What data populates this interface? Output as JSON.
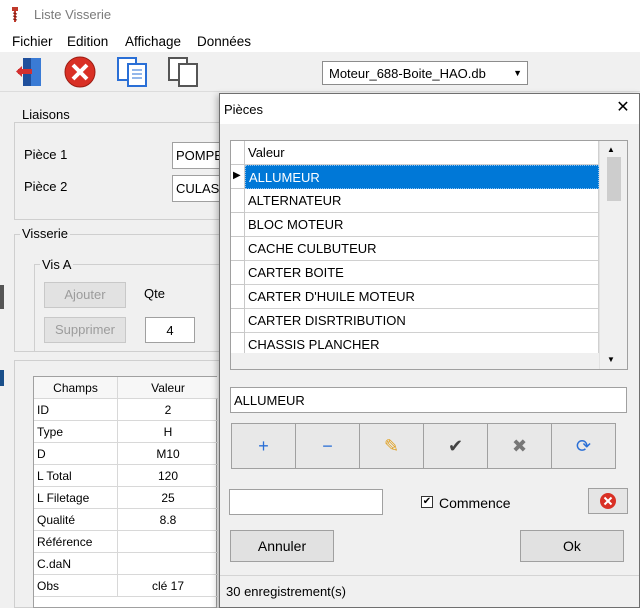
{
  "window": {
    "title": "Liste Visserie"
  },
  "menu": [
    "Fichier",
    "Edition",
    "Affichage",
    "Données"
  ],
  "toolbar": {
    "buttons": [
      {
        "icon": "exit-door-icon"
      },
      {
        "icon": "close-red-icon"
      },
      {
        "icon": "copy-icon"
      },
      {
        "icon": "duplicate-icon"
      }
    ],
    "db_file": "Moteur_688-Boite_HAO.db"
  },
  "liaisons": {
    "label": "Liaisons",
    "piece1_label": "Pièce 1",
    "piece1_value": "POMPE",
    "piece2_label": "Pièce 2",
    "piece2_value": "CULASS"
  },
  "visserie": {
    "label": "Visserie",
    "vis_label": "Vis A",
    "add_label": "Ajouter",
    "remove_label": "Supprimer",
    "qty_label": "Qte",
    "qty_value": "4"
  },
  "details": {
    "headers": [
      "Champs",
      "Valeur"
    ],
    "rows": [
      [
        "ID",
        "2"
      ],
      [
        "Type",
        "H"
      ],
      [
        "D",
        "M10"
      ],
      [
        "L Total",
        "120"
      ],
      [
        "L Filetage",
        "25"
      ],
      [
        "Qualité",
        "8.8"
      ],
      [
        "Référence",
        ""
      ],
      [
        "C.daN",
        ""
      ],
      [
        "Obs",
        "clé 17"
      ]
    ]
  },
  "dialog": {
    "title": "Pièces",
    "close": "✕",
    "column": "Valeur",
    "rows": [
      "ALLUMEUR",
      "ALTERNATEUR",
      "BLOC MOTEUR",
      "CACHE CULBUTEUR",
      "CARTER BOITE",
      "CARTER D'HUILE MOTEUR",
      "CARTER DISRTRIBUTION",
      "CHASSIS PLANCHER"
    ],
    "selected_value": "ALLUMEUR",
    "search_value": "",
    "commence_label": "Commence",
    "commence_checked": true,
    "cancel_label": "Annuler",
    "ok_label": "Ok",
    "status": "30 enregistrement(s)",
    "nav_icons": [
      "plus-icon",
      "minus-icon",
      "pencil-icon",
      "check-icon",
      "cross-icon",
      "refresh-icon"
    ],
    "nav_glyphs": [
      "+",
      "−",
      "✎",
      "✔",
      "✖",
      "⟳"
    ],
    "colors": {
      "selection": "#0078d7",
      "plus": "#2a6fd6",
      "pencil": "#e0a020",
      "refresh": "#2a6fd6",
      "close_btn": "#d93025"
    }
  }
}
